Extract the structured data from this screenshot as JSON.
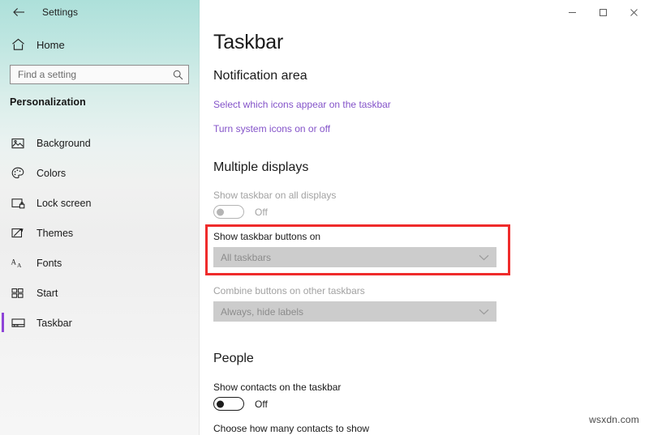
{
  "window": {
    "app_title": "Settings",
    "controls": [
      {
        "name": "minimize",
        "glyph": "minimize-icon"
      },
      {
        "name": "maximize",
        "glyph": "maximize-icon"
      },
      {
        "name": "close",
        "glyph": "close-icon"
      }
    ]
  },
  "sidebar": {
    "back_icon": "back-arrow-icon",
    "home": {
      "label": "Home",
      "icon": "home-icon"
    },
    "search": {
      "value": "",
      "placeholder": "Find a setting",
      "icon": "search-icon"
    },
    "section_heading": "Personalization",
    "accent_color": "#8e44d8",
    "gradient_top_color": "#ade0da",
    "items": [
      {
        "label": "Background",
        "icon": "image-icon",
        "selected": false
      },
      {
        "label": "Colors",
        "icon": "palette-icon",
        "selected": false
      },
      {
        "label": "Lock screen",
        "icon": "lock-screen-icon",
        "selected": false
      },
      {
        "label": "Themes",
        "icon": "brush-icon",
        "selected": false
      },
      {
        "label": "Fonts",
        "icon": "fonts-icon",
        "selected": false
      },
      {
        "label": "Start",
        "icon": "start-grid-icon",
        "selected": false
      },
      {
        "label": "Taskbar",
        "icon": "taskbar-icon",
        "selected": true
      }
    ]
  },
  "main": {
    "page_title": "Taskbar",
    "notification_area": {
      "heading": "Notification area",
      "links": [
        "Select which icons appear on the taskbar",
        "Turn system icons on or off"
      ]
    },
    "multiple_displays": {
      "heading": "Multiple displays",
      "show_taskbar_all_displays": {
        "label": "Show taskbar on all displays",
        "state": "Off",
        "disabled": true
      },
      "show_taskbar_buttons_on": {
        "label": "Show taskbar buttons on",
        "value": "All taskbars",
        "disabled": true,
        "highlighted": true
      },
      "combine_buttons_other": {
        "label": "Combine buttons on other taskbars",
        "value": "Always, hide labels",
        "disabled": true
      }
    },
    "people": {
      "heading": "People",
      "show_contacts": {
        "label": "Show contacts on the taskbar",
        "state": "Off",
        "disabled": false
      },
      "choose_how_many_label": "Choose how many contacts to show"
    }
  },
  "highlight": {
    "color": "#ef2b2b"
  },
  "watermark": "wsxdn.com"
}
